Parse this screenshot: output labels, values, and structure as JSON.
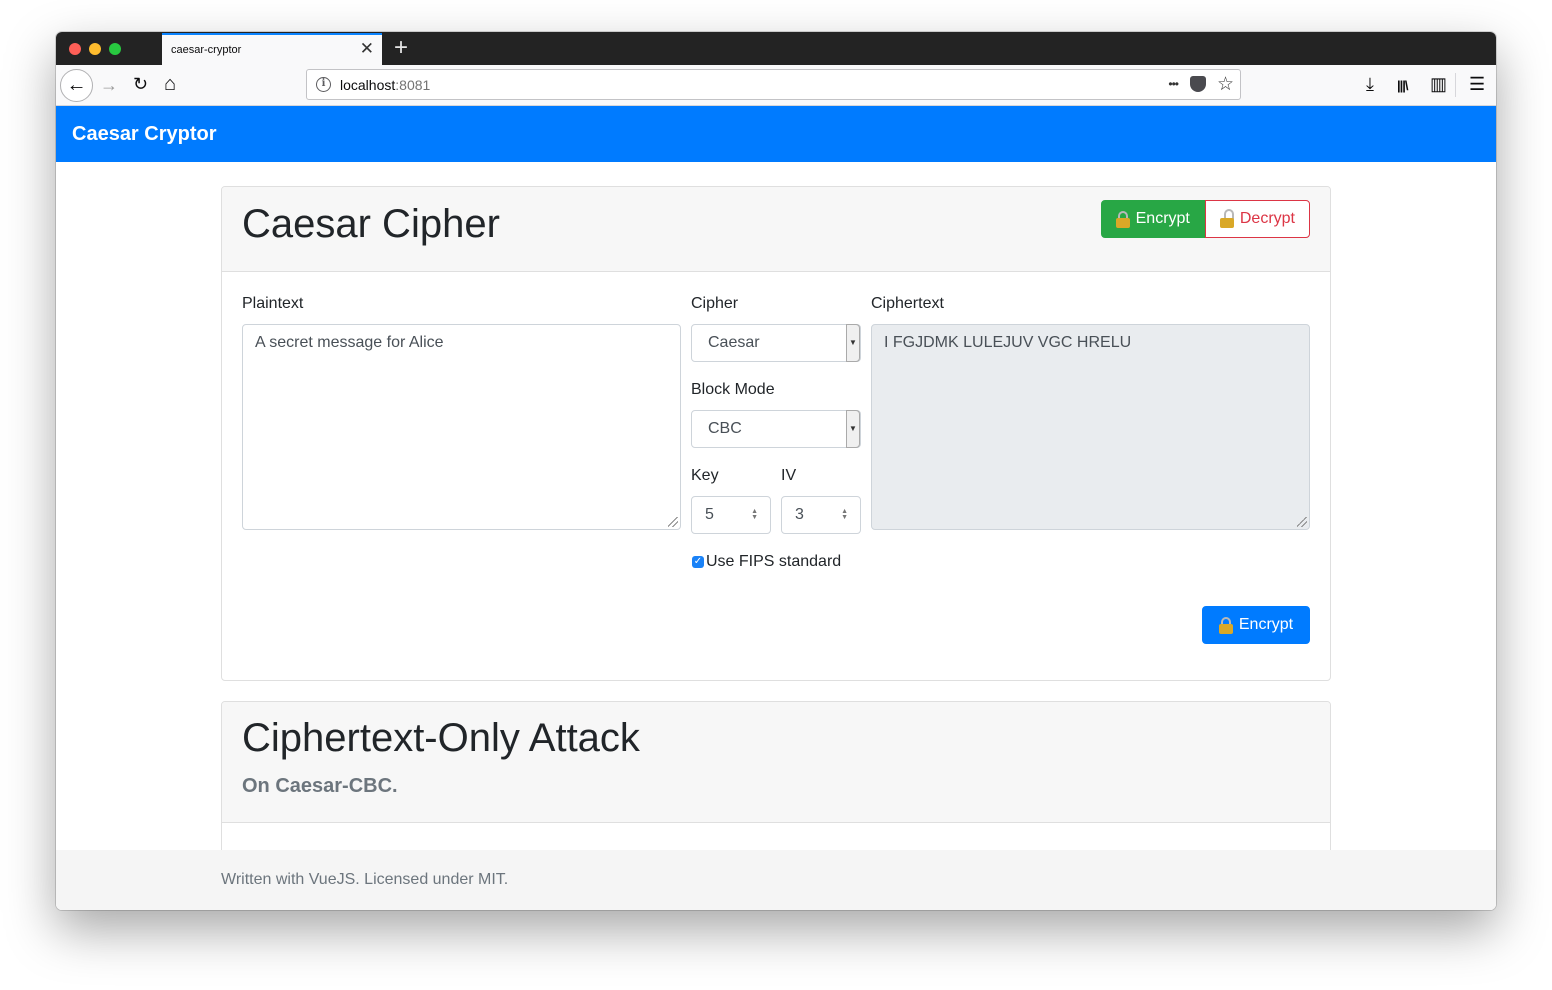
{
  "browser": {
    "tab_title": "caesar-cryptor",
    "new_tab_glyph": "+",
    "close_glyph": "✕",
    "url_host": "localhost",
    "url_port": ":8081",
    "back_glyph": "←",
    "forward_glyph": "→",
    "reload_glyph": "↻",
    "home_glyph": "⌂",
    "page_actions_glyph": "•••",
    "bookmark_glyph": "☆",
    "download_glyph": "⤓",
    "library_glyph": "|||\\",
    "sidebar_glyph": "▥",
    "menu_glyph": "☰"
  },
  "app": {
    "brand": "Caesar Cryptor"
  },
  "cipher_card": {
    "title": "Caesar Cipher",
    "encrypt_tab": "Encrypt",
    "decrypt_tab": "Decrypt",
    "plaintext_label": "Plaintext",
    "plaintext_value": "A secret message for Alice",
    "cipher_label": "Cipher",
    "cipher_value": "Caesar",
    "block_mode_label": "Block Mode",
    "block_mode_value": "CBC",
    "key_label": "Key",
    "key_value": "5",
    "iv_label": "IV",
    "iv_value": "3",
    "fips_label": "Use FIPS standard",
    "fips_checked": true,
    "ciphertext_label": "Ciphertext",
    "ciphertext_value": "I FGJDMK LULEJUV VGC HRELU",
    "submit_label": "Encrypt"
  },
  "attack_card": {
    "title": "Ciphertext-Only Attack",
    "subtitle": "On Caesar-CBC."
  },
  "footer": {
    "text": "Written with VueJS. Licensed under MIT."
  },
  "colors": {
    "primary": "#007bff",
    "success": "#28a745",
    "danger": "#dc3545"
  }
}
